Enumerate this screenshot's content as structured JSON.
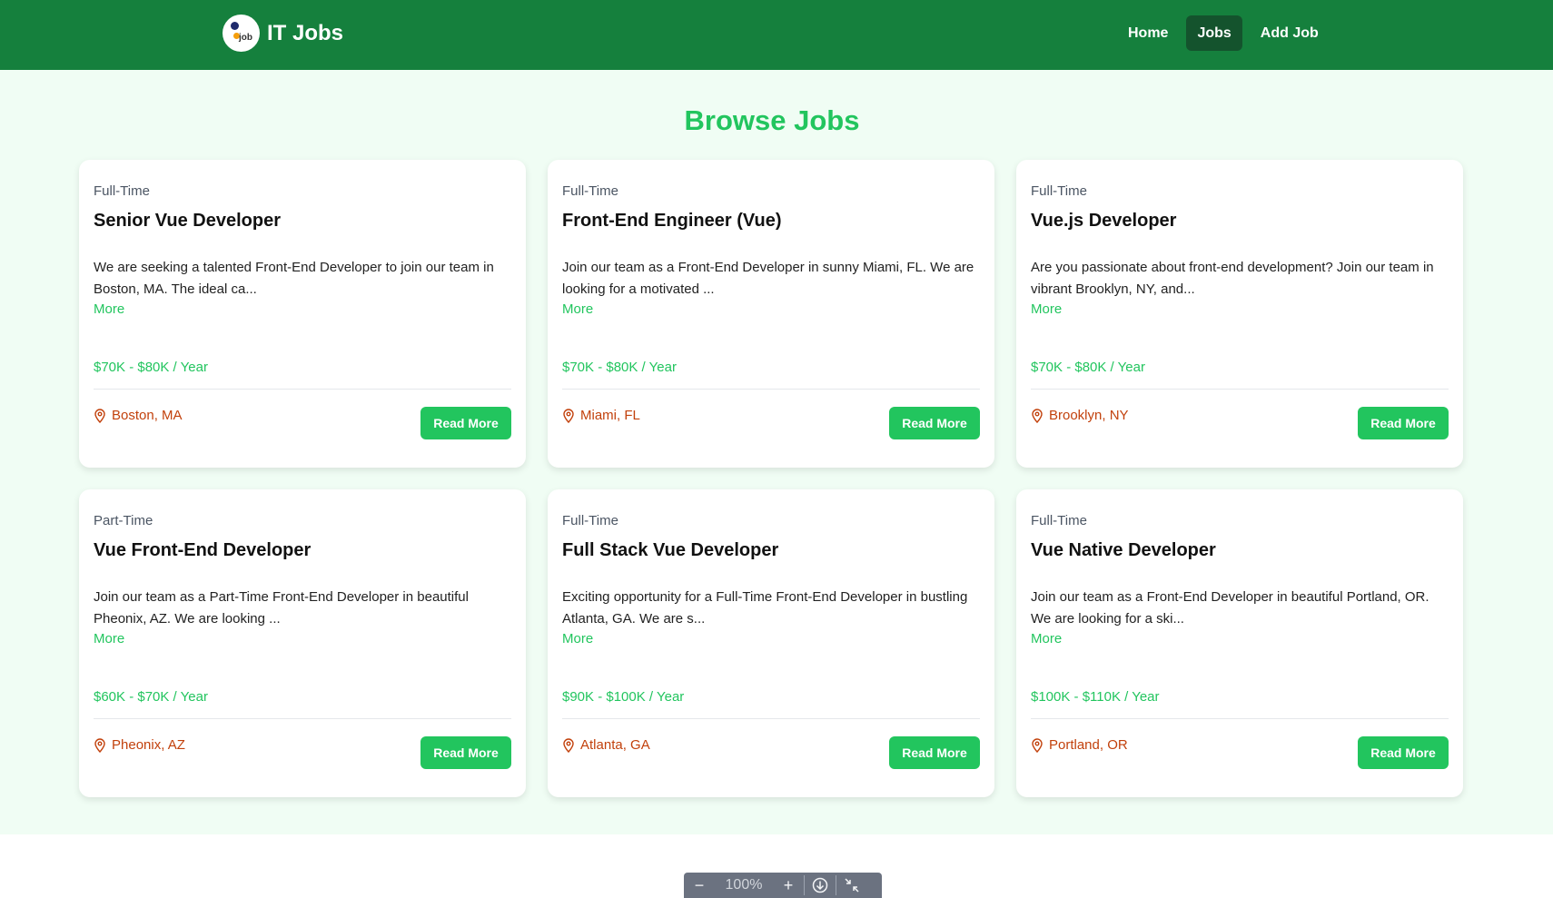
{
  "navbar": {
    "logo_text": "job",
    "brand_title": "IT Jobs",
    "links": [
      {
        "label": "Home",
        "active": false
      },
      {
        "label": "Jobs",
        "active": true
      },
      {
        "label": "Add Job",
        "active": false
      }
    ]
  },
  "main": {
    "title": "Browse Jobs",
    "jobs": [
      {
        "type": "Full-Time",
        "title": "Senior Vue Developer",
        "description": "We are seeking a talented Front-End Developer to join our team in Boston, MA. The ideal ca...",
        "more": "More",
        "salary": "$70K - $80K / Year",
        "location": "Boston, MA",
        "button": "Read More"
      },
      {
        "type": "Full-Time",
        "title": "Front-End Engineer (Vue)",
        "description": "Join our team as a Front-End Developer in sunny Miami, FL. We are looking for a motivated ...",
        "more": "More",
        "salary": "$70K - $80K / Year",
        "location": "Miami, FL",
        "button": "Read More"
      },
      {
        "type": "Full-Time",
        "title": "Vue.js Developer",
        "description": "Are you passionate about front-end development? Join our team in vibrant Brooklyn, NY, and...",
        "more": "More",
        "salary": "$70K - $80K / Year",
        "location": "Brooklyn, NY",
        "button": "Read More"
      },
      {
        "type": "Part-Time",
        "title": "Vue Front-End Developer",
        "description": "Join our team as a Part-Time Front-End Developer in beautiful Pheonix, AZ. We are looking ...",
        "more": "More",
        "salary": "$60K - $70K / Year",
        "location": "Pheonix, AZ",
        "button": "Read More"
      },
      {
        "type": "Full-Time",
        "title": "Full Stack Vue Developer",
        "description": "Exciting opportunity for a Full-Time Front-End Developer in bustling Atlanta, GA. We are s...",
        "more": "More",
        "salary": "$90K - $100K / Year",
        "location": "Atlanta, GA",
        "button": "Read More"
      },
      {
        "type": "Full-Time",
        "title": "Vue Native Developer",
        "description": "Join our team as a Front-End Developer in beautiful Portland, OR. We are looking for a ski...",
        "more": "More",
        "salary": "$100K - $110K / Year",
        "location": "Portland, OR",
        "button": "Read More"
      }
    ]
  },
  "zoom": {
    "minus": "−",
    "value": "100%",
    "plus": "+",
    "download_icon": "download-icon",
    "fit_icon": "collapse-icon"
  },
  "colors": {
    "nav_bg": "#15803d",
    "accent": "#22c55e",
    "location": "#c2410c",
    "page_bg": "#f0fdf4"
  }
}
